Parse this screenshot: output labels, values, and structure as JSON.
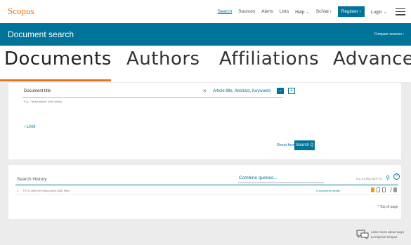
{
  "header": {
    "logo": "Scopus",
    "nav": [
      "Search",
      "Sources",
      "Alerts",
      "Lists",
      "Help ⌄",
      "SciVal ›"
    ],
    "register": "Register ›",
    "login": "Login ⌄"
  },
  "band": {
    "title": "Document search",
    "compare": "Compare sources ›"
  },
  "tabs": [
    "Documents",
    "Authors",
    "Affiliations",
    "Advanced"
  ],
  "search_form": {
    "field_label": "Document title",
    "field_hint": "E.g., \"heart attack\" AND stress",
    "scope": "Article title, Abstract, Keywords",
    "scope_btn": "⌄",
    "add_btn": "+",
    "limit": "› Limit",
    "reset": "Reset form",
    "search": "Search Q"
  },
  "history": {
    "title": "Search History",
    "combine": "Combine queries...",
    "example": "e.g. #1 AND NOT #3",
    "row": {
      "num": "1",
      "query": "TITLE-ABS-KEY(document AND filter)",
      "results": "0 document results"
    },
    "top_of_page": "^ Top of page"
  },
  "feedback": {
    "text": "Learn more about ways to Improve Scopus"
  },
  "colors": {
    "brand_orange": "#e9711c",
    "brand_teal": "#007398"
  }
}
